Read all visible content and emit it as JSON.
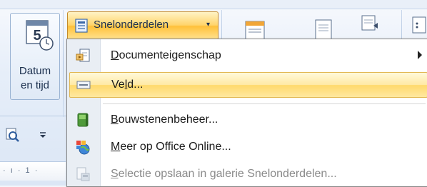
{
  "ribbon": {
    "date_time": {
      "line1": "Datum",
      "line2": "en tijd",
      "calendar_digit": "5"
    },
    "quick_parts": {
      "label": "Snelonderdelen",
      "arrow": "▾"
    },
    "ruler_text": "· ı · 1 ·"
  },
  "menu": {
    "items": [
      {
        "pre": "",
        "mnemonic": "D",
        "post": "ocumenteigenschap",
        "has_submenu": true,
        "highlighted": false,
        "disabled": false
      },
      {
        "pre": "Ve",
        "mnemonic": "l",
        "post": "d...",
        "has_submenu": false,
        "highlighted": true,
        "disabled": false
      },
      {
        "pre": "",
        "mnemonic": "B",
        "post": "ouwstenenbeheer...",
        "has_submenu": false,
        "highlighted": false,
        "disabled": false
      },
      {
        "pre": "",
        "mnemonic": "M",
        "post": "eer op Office Online...",
        "has_submenu": false,
        "highlighted": false,
        "disabled": false
      },
      {
        "pre": "",
        "mnemonic": "S",
        "post": "electie opslaan in galerie Snelonderdelen...",
        "has_submenu": false,
        "highlighted": false,
        "disabled": true
      }
    ]
  },
  "colors": {
    "highlight": "#ffe9a4",
    "button_hot": "#ffc13a",
    "menu_gutter": "#e9eef4"
  }
}
